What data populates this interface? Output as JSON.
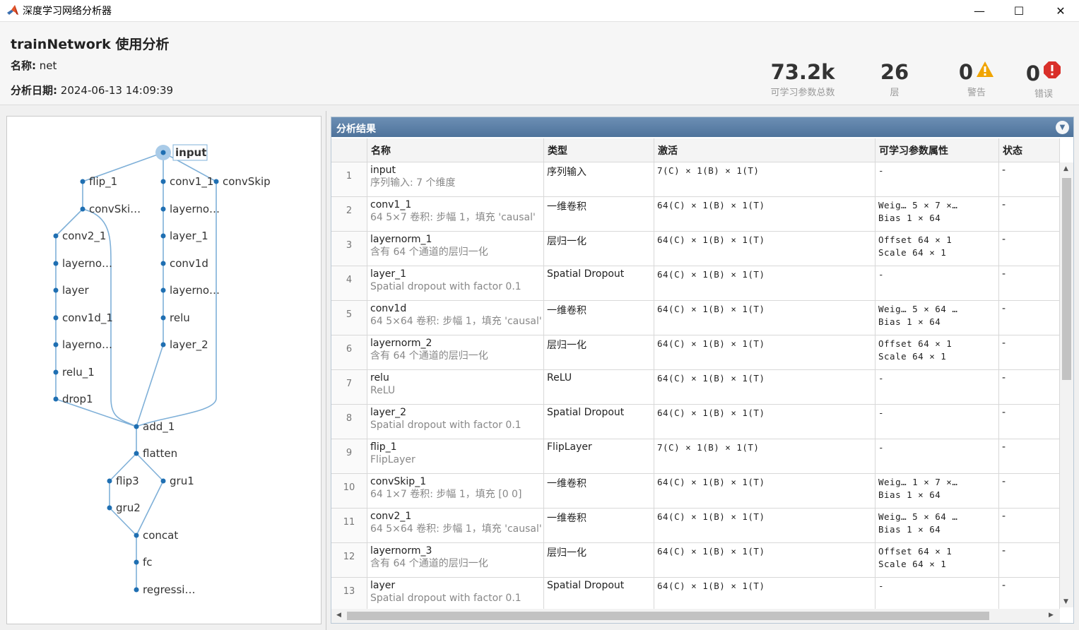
{
  "window": {
    "title": "深度学习网络分析器",
    "minimize_glyph": "—",
    "maximize_glyph": "☐",
    "close_glyph": "✕"
  },
  "header": {
    "title": "trainNetwork 使用分析",
    "name_label": "名称:",
    "name_value": "net",
    "date_label": "分析日期:",
    "date_value": "2024-06-13 14:09:39"
  },
  "stats": {
    "params": {
      "value": "73.2k",
      "label": "可学习参数总数"
    },
    "layers": {
      "value": "26",
      "label": "层"
    },
    "warnings": {
      "value": "0",
      "label": "警告",
      "icon": "warning-icon"
    },
    "errors": {
      "value": "0",
      "label": "错误",
      "icon": "error-icon"
    }
  },
  "colors": {
    "accent": "#4e739b",
    "graph_edge": "#7fb0d8",
    "graph_node": "#1f6fb2",
    "warning": "#f0a400",
    "error": "#d9302a"
  },
  "graph": {
    "nodes": [
      {
        "id": "input",
        "label": "input"
      },
      {
        "id": "flip_1",
        "label": "flip_1"
      },
      {
        "id": "conv1_1",
        "label": "conv1_1"
      },
      {
        "id": "convSkip",
        "label": "convSkip"
      },
      {
        "id": "convSki",
        "label": "convSki…"
      },
      {
        "id": "layerno_a",
        "label": "layerno…"
      },
      {
        "id": "conv2_1",
        "label": "conv2_1"
      },
      {
        "id": "layer_1",
        "label": "layer_1"
      },
      {
        "id": "layerno_b",
        "label": "layerno…"
      },
      {
        "id": "conv1d",
        "label": "conv1d"
      },
      {
        "id": "layer",
        "label": "layer"
      },
      {
        "id": "layerno_c",
        "label": "layerno…"
      },
      {
        "id": "conv1d_1",
        "label": "conv1d_1"
      },
      {
        "id": "relu",
        "label": "relu"
      },
      {
        "id": "layerno_d",
        "label": "layerno…"
      },
      {
        "id": "layer_2",
        "label": "layer_2"
      },
      {
        "id": "relu_1",
        "label": "relu_1"
      },
      {
        "id": "drop1",
        "label": "drop1"
      },
      {
        "id": "add_1",
        "label": "add_1"
      },
      {
        "id": "flatten",
        "label": "flatten"
      },
      {
        "id": "flip3",
        "label": "flip3"
      },
      {
        "id": "gru1",
        "label": "gru1"
      },
      {
        "id": "gru2",
        "label": "gru2"
      },
      {
        "id": "concat",
        "label": "concat"
      },
      {
        "id": "fc",
        "label": "fc"
      },
      {
        "id": "regressi",
        "label": "regressi…"
      }
    ]
  },
  "results": {
    "panel_title": "分析结果",
    "columns": [
      "名称",
      "类型",
      "激活",
      "可学习参数属性",
      "状态"
    ],
    "rows": [
      {
        "idx": "1",
        "name": "input",
        "desc": "序列输入: 7 个维度",
        "type": "序列输入",
        "act": "7(C) × 1(B) × 1(T)",
        "p1": "-",
        "p2": "",
        "status": "-"
      },
      {
        "idx": "2",
        "name": "conv1_1",
        "desc": "64 5×7 卷积: 步幅 1，填充 'causal'",
        "type": "一维卷积",
        "act": "64(C) × 1(B) × 1(T)",
        "p1": "Weig… 5 × 7 ×…",
        "p2": "Bias   1 × 64",
        "status": "-"
      },
      {
        "idx": "3",
        "name": "layernorm_1",
        "desc": "含有 64 个通道的层归一化",
        "type": "层归一化",
        "act": "64(C) × 1(B) × 1(T)",
        "p1": "Offset 64 × 1",
        "p2": "Scale  64 × 1",
        "status": "-"
      },
      {
        "idx": "4",
        "name": "layer_1",
        "desc": "Spatial dropout with factor 0.1",
        "type": "Spatial Dropout",
        "act": "64(C) × 1(B) × 1(T)",
        "p1": "-",
        "p2": "",
        "status": "-"
      },
      {
        "idx": "5",
        "name": "conv1d",
        "desc": "64 5×64 卷积: 步幅 1，填充 'causal'",
        "type": "一维卷积",
        "act": "64(C) × 1(B) × 1(T)",
        "p1": "Weig… 5 × 64 …",
        "p2": "Bias   1 × 64",
        "status": "-"
      },
      {
        "idx": "6",
        "name": "layernorm_2",
        "desc": "含有 64 个通道的层归一化",
        "type": "层归一化",
        "act": "64(C) × 1(B) × 1(T)",
        "p1": "Offset 64 × 1",
        "p2": "Scale  64 × 1",
        "status": "-"
      },
      {
        "idx": "7",
        "name": "relu",
        "desc": "ReLU",
        "type": "ReLU",
        "act": "64(C) × 1(B) × 1(T)",
        "p1": "-",
        "p2": "",
        "status": "-"
      },
      {
        "idx": "8",
        "name": "layer_2",
        "desc": "Spatial dropout with factor 0.1",
        "type": "Spatial Dropout",
        "act": "64(C) × 1(B) × 1(T)",
        "p1": "-",
        "p2": "",
        "status": "-"
      },
      {
        "idx": "9",
        "name": "flip_1",
        "desc": "FlipLayer",
        "type": "FlipLayer",
        "act": "7(C) × 1(B) × 1(T)",
        "p1": "-",
        "p2": "",
        "status": "-"
      },
      {
        "idx": "10",
        "name": "convSkip_1",
        "desc": "64 1×7 卷积: 步幅 1，填充 [0 0]",
        "type": "一维卷积",
        "act": "64(C) × 1(B) × 1(T)",
        "p1": "Weig… 1 × 7 ×…",
        "p2": "Bias   1 × 64",
        "status": "-"
      },
      {
        "idx": "11",
        "name": "conv2_1",
        "desc": "64 5×64 卷积: 步幅 1，填充 'causal'",
        "type": "一维卷积",
        "act": "64(C) × 1(B) × 1(T)",
        "p1": "Weig… 5 × 64 …",
        "p2": "Bias   1 × 64",
        "status": "-"
      },
      {
        "idx": "12",
        "name": "layernorm_3",
        "desc": "含有 64 个通道的层归一化",
        "type": "层归一化",
        "act": "64(C) × 1(B) × 1(T)",
        "p1": "Offset 64 × 1",
        "p2": "Scale  64 × 1",
        "status": "-"
      },
      {
        "idx": "13",
        "name": "layer",
        "desc": "Spatial dropout with factor 0.1",
        "type": "Spatial Dropout",
        "act": "64(C) × 1(B) × 1(T)",
        "p1": "-",
        "p2": "",
        "status": "-"
      }
    ]
  }
}
